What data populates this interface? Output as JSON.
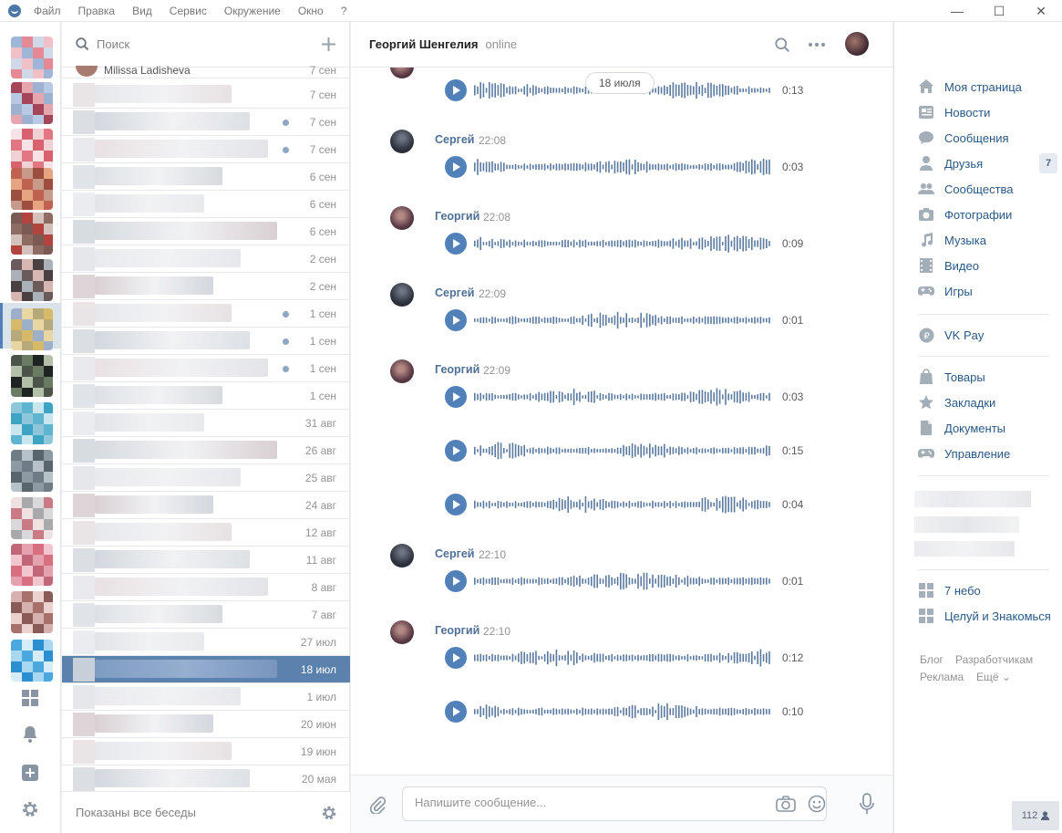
{
  "menu": [
    "Файл",
    "Правка",
    "Вид",
    "Сервис",
    "Окружение",
    "Окно",
    "?"
  ],
  "window_controls": {
    "minimize": "—",
    "maximize": "☐",
    "close": "✕"
  },
  "dialogs": {
    "search_placeholder": "Поиск",
    "first_row_name": "Milissa Ladisheva",
    "dates": [
      "7 сен",
      "7 сен",
      "7 сен",
      "7 сен",
      "6 сен",
      "6 сен",
      "6 сен",
      "2 сен",
      "2 сен",
      "1 сен",
      "1 сен",
      "1 сен",
      "1 сен",
      "31 авг",
      "26 авг",
      "25 авг",
      "24 авг",
      "12 авг",
      "11 авг",
      "8 авг",
      "7 авг",
      "27 июл",
      "18 июл",
      "1 июл",
      "20 июн",
      "19 июн",
      "20 мая"
    ],
    "unread": [
      false,
      false,
      true,
      true,
      false,
      false,
      false,
      false,
      false,
      true,
      true,
      true,
      false,
      false,
      false,
      false,
      false,
      false,
      false,
      false,
      false,
      false,
      false,
      false,
      false,
      false,
      false
    ],
    "selected_index": 22,
    "footer": "Показаны все беседы"
  },
  "chat": {
    "peer_name": "Георгий Шенгелия",
    "peer_status": "online",
    "date_divider": "18 июля",
    "messages": [
      {
        "author": "",
        "time": "",
        "avatar": "g",
        "voices": [
          "0:13"
        ]
      },
      {
        "author": "Сергей",
        "time": "22:08",
        "avatar": "s",
        "voices": [
          "0:03"
        ]
      },
      {
        "author": "Георгий",
        "time": "22:08",
        "avatar": "g",
        "voices": [
          "0:09"
        ]
      },
      {
        "author": "Сергей",
        "time": "22:09",
        "avatar": "s",
        "voices": [
          "0:01"
        ]
      },
      {
        "author": "Георгий",
        "time": "22:09",
        "avatar": "g",
        "voices": [
          "0:03",
          "0:15",
          "0:04"
        ]
      },
      {
        "author": "Сергей",
        "time": "22:10",
        "avatar": "s",
        "voices": [
          "0:01"
        ]
      },
      {
        "author": "Георгий",
        "time": "22:10",
        "avatar": "g",
        "voices": [
          "0:12",
          "0:10"
        ]
      }
    ],
    "composer_placeholder": "Напишите сообщение..."
  },
  "nav": {
    "items": [
      {
        "label": "Моя страница",
        "icon": "home-icon"
      },
      {
        "label": "Новости",
        "icon": "news-icon"
      },
      {
        "label": "Сообщения",
        "icon": "messages-icon"
      },
      {
        "label": "Друзья",
        "icon": "friends-icon"
      },
      {
        "label": "Сообщества",
        "icon": "groups-icon"
      },
      {
        "label": "Фотографии",
        "icon": "camera-icon"
      },
      {
        "label": "Музыка",
        "icon": "music-icon"
      },
      {
        "label": "Видео",
        "icon": "video-icon"
      },
      {
        "label": "Игры",
        "icon": "gamepad-icon"
      }
    ],
    "friends_badge": "7",
    "pay": "VK Pay",
    "items2": [
      {
        "label": "Товары",
        "icon": "bag-icon"
      },
      {
        "label": "Закладки",
        "icon": "star-icon"
      },
      {
        "label": "Документы",
        "icon": "document-icon"
      },
      {
        "label": "Управление",
        "icon": "gamepad-icon"
      }
    ],
    "apps": [
      "7 небо",
      "Целуй и Знакомься"
    ],
    "footer_links": [
      "Блог",
      "Разработчикам",
      "Реклама",
      "Ещё ⌄"
    ],
    "online_count": "112"
  },
  "colors": {
    "accent": "#5181b8",
    "link": "#2a5885",
    "selected_row": "#5b81ad"
  }
}
